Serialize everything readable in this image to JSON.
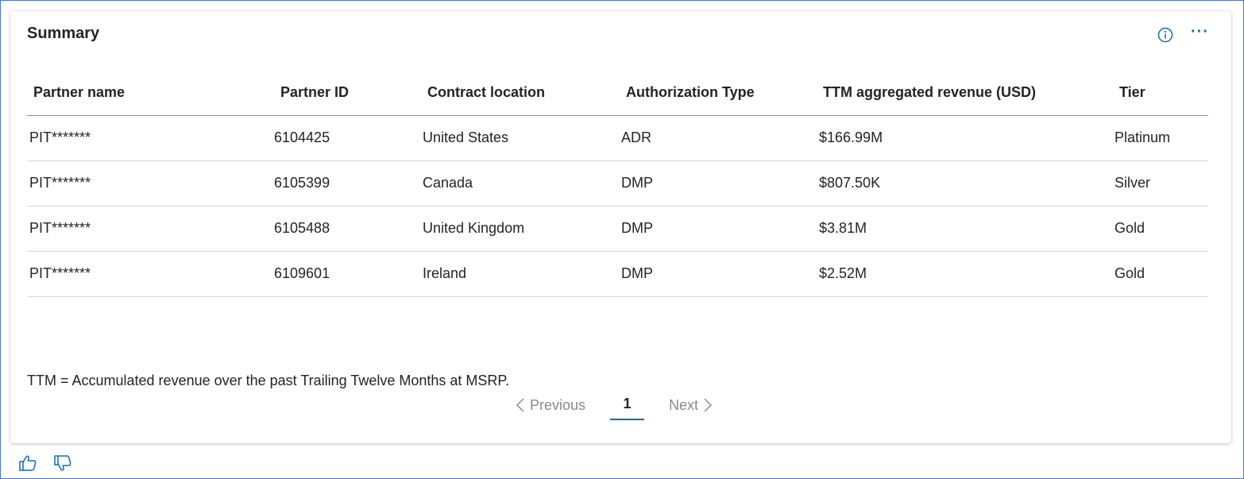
{
  "card": {
    "title": "Summary",
    "info_icon": "info-icon",
    "more_icon": "more-icon",
    "more_label": "···"
  },
  "table": {
    "columns": [
      "Partner name",
      "Partner ID",
      "Contract location",
      "Authorization Type",
      "TTM aggregated revenue (USD)",
      "Tier"
    ],
    "rows": [
      [
        "PIT*******",
        "6104425",
        "United States",
        "ADR",
        "$166.99M",
        "Platinum"
      ],
      [
        "PIT*******",
        "6105399",
        "Canada",
        "DMP",
        "$807.50K",
        "Silver"
      ],
      [
        "PIT*******",
        "6105488",
        "United Kingdom",
        "DMP",
        "$3.81M",
        "Gold"
      ],
      [
        "PIT*******",
        "6109601",
        "Ireland",
        "DMP",
        "$2.52M",
        "Gold"
      ]
    ]
  },
  "footnote": "TTM = Accumulated revenue over the past Trailing Twelve Months at MSRP.",
  "pagination": {
    "previous_label": "Previous",
    "current_page": "1",
    "next_label": "Next"
  },
  "feedback": {
    "like_icon": "thumbs-up-icon",
    "dislike_icon": "thumbs-down-icon"
  },
  "colors": {
    "accent": "#0f6cbd",
    "frame_border": "#4a78c2",
    "disabled_text": "#8a8a8a"
  }
}
